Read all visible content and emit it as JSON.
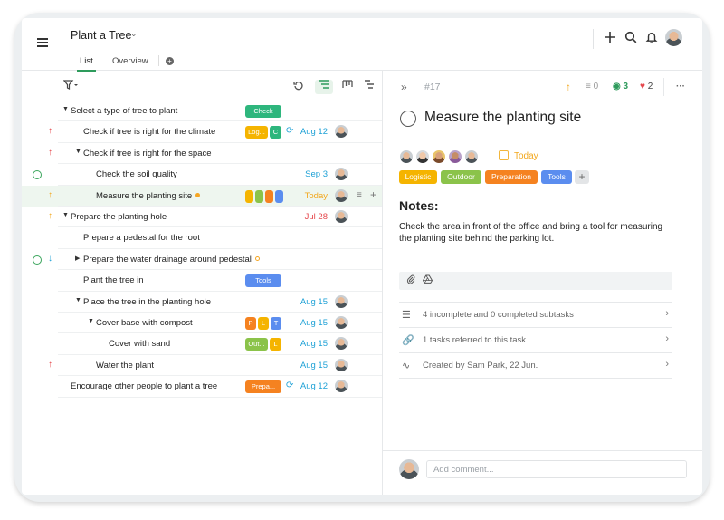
{
  "header": {
    "project_title": "Plant a Tree",
    "tabs": [
      {
        "label": "List"
      },
      {
        "label": "Overview"
      }
    ]
  },
  "task_list": {
    "rows": [
      {
        "title": "Select a type of tree to plant",
        "indent": 0,
        "expander": "down",
        "priority": "",
        "status": "",
        "tags": [
          {
            "label": "Check",
            "color": "#2eb67d",
            "w": 40
          }
        ],
        "date": "",
        "date_color": "",
        "repeat": false,
        "avatar": false
      },
      {
        "title": "Check if tree is right for the climate",
        "indent": 1,
        "expander": "",
        "priority": "↑",
        "priority_color": "#e5484d",
        "status": "",
        "tags": [
          {
            "label": "Log...",
            "color": "#f5b400",
            "w": 25
          },
          {
            "label": "C",
            "color": "#2eb67d",
            "w": 13
          }
        ],
        "date": "Aug 12",
        "date_color": "#1ea1d6",
        "repeat": true,
        "avatar": true
      },
      {
        "title": "Check if tree is right for the space",
        "indent": 1,
        "expander": "down",
        "priority": "↑",
        "priority_color": "#e5484d",
        "status": "",
        "tags": [],
        "date": "",
        "date_color": "",
        "repeat": false,
        "avatar": false
      },
      {
        "title": "Check the soil quality",
        "indent": 2,
        "expander": "",
        "priority": "",
        "status": "open",
        "tags": [],
        "date": "Sep 3",
        "date_color": "#1ea1d6",
        "repeat": false,
        "avatar": true
      },
      {
        "title": "Measure the planting site",
        "indent": 2,
        "expander": "",
        "priority": "↑",
        "priority_color": "#f2a81f",
        "status": "",
        "dot": "#f5a623",
        "selected": true,
        "tags": [
          {
            "label": "",
            "color": "#f5b400",
            "w": 9
          },
          {
            "label": "",
            "color": "#8bc34a",
            "w": 9
          },
          {
            "label": "",
            "color": "#f58220",
            "w": 9
          },
          {
            "label": "",
            "color": "#5b8def",
            "w": 9
          }
        ],
        "date": "Today",
        "date_color": "#f2a81f",
        "repeat": false,
        "avatar": true
      },
      {
        "title": "Prepare the planting hole",
        "indent": 0,
        "expander": "down",
        "priority": "↑",
        "priority_color": "#f2a81f",
        "status": "",
        "tags": [],
        "date": "Jul 28",
        "date_color": "#e5484d",
        "repeat": false,
        "avatar": true
      },
      {
        "title": "Prepare a pedestal for the root",
        "indent": 1,
        "expander": "",
        "priority": "",
        "status": "",
        "tags": [],
        "date": "",
        "date_color": "",
        "repeat": false,
        "avatar": false
      },
      {
        "title": "Prepare the water drainage around pedestal",
        "indent": 1,
        "expander": "right",
        "priority": "↓",
        "priority_color": "#1ea1d6",
        "status": "open",
        "dot": "ring",
        "tags": [],
        "date": "",
        "date_color": "",
        "repeat": false,
        "avatar": false
      },
      {
        "title": "Plant the tree in",
        "indent": 1,
        "expander": "",
        "priority": "",
        "status": "",
        "tags": [
          {
            "label": "Tools",
            "color": "#5b8def",
            "w": 40
          }
        ],
        "date": "",
        "date_color": "",
        "repeat": false,
        "avatar": false
      },
      {
        "title": "Place the tree in the planting hole",
        "indent": 1,
        "expander": "down",
        "priority": "",
        "status": "",
        "tags": [],
        "date": "Aug 15",
        "date_color": "#1ea1d6",
        "repeat": false,
        "avatar": true
      },
      {
        "title": "Cover base with compost",
        "indent": 2,
        "expander": "down",
        "priority": "",
        "status": "",
        "tags": [
          {
            "label": "P",
            "color": "#f58220",
            "w": 12
          },
          {
            "label": "L",
            "color": "#f5b400",
            "w": 12
          },
          {
            "label": "T",
            "color": "#5b8def",
            "w": 12
          }
        ],
        "date": "Aug 15",
        "date_color": "#1ea1d6",
        "repeat": false,
        "avatar": true
      },
      {
        "title": "Cover with sand",
        "indent": 3,
        "expander": "",
        "priority": "",
        "status": "",
        "tags": [
          {
            "label": "Out...",
            "color": "#8bc34a",
            "w": 25
          },
          {
            "label": "L",
            "color": "#f5b400",
            "w": 13
          }
        ],
        "date": "Aug 15",
        "date_color": "#1ea1d6",
        "repeat": false,
        "avatar": true
      },
      {
        "title": "Water the plant",
        "indent": 2,
        "expander": "",
        "priority": "↑",
        "priority_color": "#e5484d",
        "status": "",
        "tags": [],
        "date": "Aug 15",
        "date_color": "#1ea1d6",
        "repeat": false,
        "avatar": true
      },
      {
        "title": "Encourage other people to plant a tree",
        "indent": 0,
        "expander": "",
        "priority": "",
        "status": "",
        "tags": [
          {
            "label": "Prepa...",
            "color": "#f58220",
            "w": 40
          }
        ],
        "date": "Aug 12",
        "date_color": "#1ea1d6",
        "repeat": true,
        "avatar": true
      }
    ]
  },
  "task_detail": {
    "number": "#17",
    "title": "Measure the planting site",
    "subtask_count": "0",
    "watchers": "3",
    "likes": "2",
    "due": "Today",
    "tags": [
      {
        "label": "Logistic",
        "color": "#f5b400"
      },
      {
        "label": "Outdoor",
        "color": "#8bc34a"
      },
      {
        "label": "Preparation",
        "color": "#f58220"
      },
      {
        "label": "Tools",
        "color": "#5b8def"
      }
    ],
    "notes_heading": "Notes:",
    "notes_body": "Check the area in front of the office and bring a tool for measuring the planting site behind the parking lot.",
    "meta": [
      {
        "icon": "subtasks-icon",
        "text": "4 incomplete and 0 completed subtasks"
      },
      {
        "icon": "link-icon",
        "text": "1 tasks referred to this task"
      },
      {
        "icon": "activity-icon",
        "text": "Created by Sam Park, 22 Jun."
      }
    ],
    "comment_placeholder": "Add comment..."
  },
  "colors": {
    "accent": "#2e9b5c",
    "date_blue": "#1ea1d6",
    "overdue": "#e5484d",
    "today": "#f2a81f"
  }
}
